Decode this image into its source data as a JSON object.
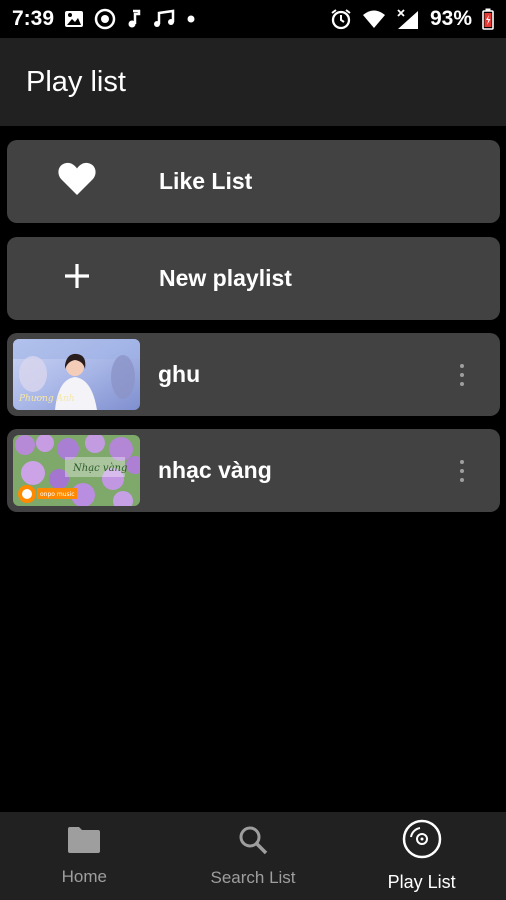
{
  "status_bar": {
    "time": "7:39",
    "battery": "93%",
    "left_icons": [
      "image-icon",
      "target-icon",
      "music-note-icon",
      "music-notes-icon",
      "dot-icon"
    ],
    "right_icons": [
      "alarm-icon",
      "wifi-icon",
      "signal-icon",
      "battery-icon"
    ]
  },
  "header": {
    "title": "Play list"
  },
  "actions": [
    {
      "label": "Like List",
      "icon": "heart-icon"
    },
    {
      "label": "New playlist",
      "icon": "plus-icon"
    }
  ],
  "playlists": [
    {
      "name": "ghu"
    },
    {
      "name": "nhạc vàng"
    }
  ],
  "bottom_nav": [
    {
      "label": "Home",
      "icon": "folder-icon",
      "active": false
    },
    {
      "label": "Search List",
      "icon": "search-icon",
      "active": false
    },
    {
      "label": "Play List",
      "icon": "disc-icon",
      "active": true
    }
  ],
  "colors": {
    "background": "#000000",
    "surface": "#212121",
    "card": "#424242",
    "inactive": "#9e9e9e",
    "battery_accent": "#e53935"
  }
}
